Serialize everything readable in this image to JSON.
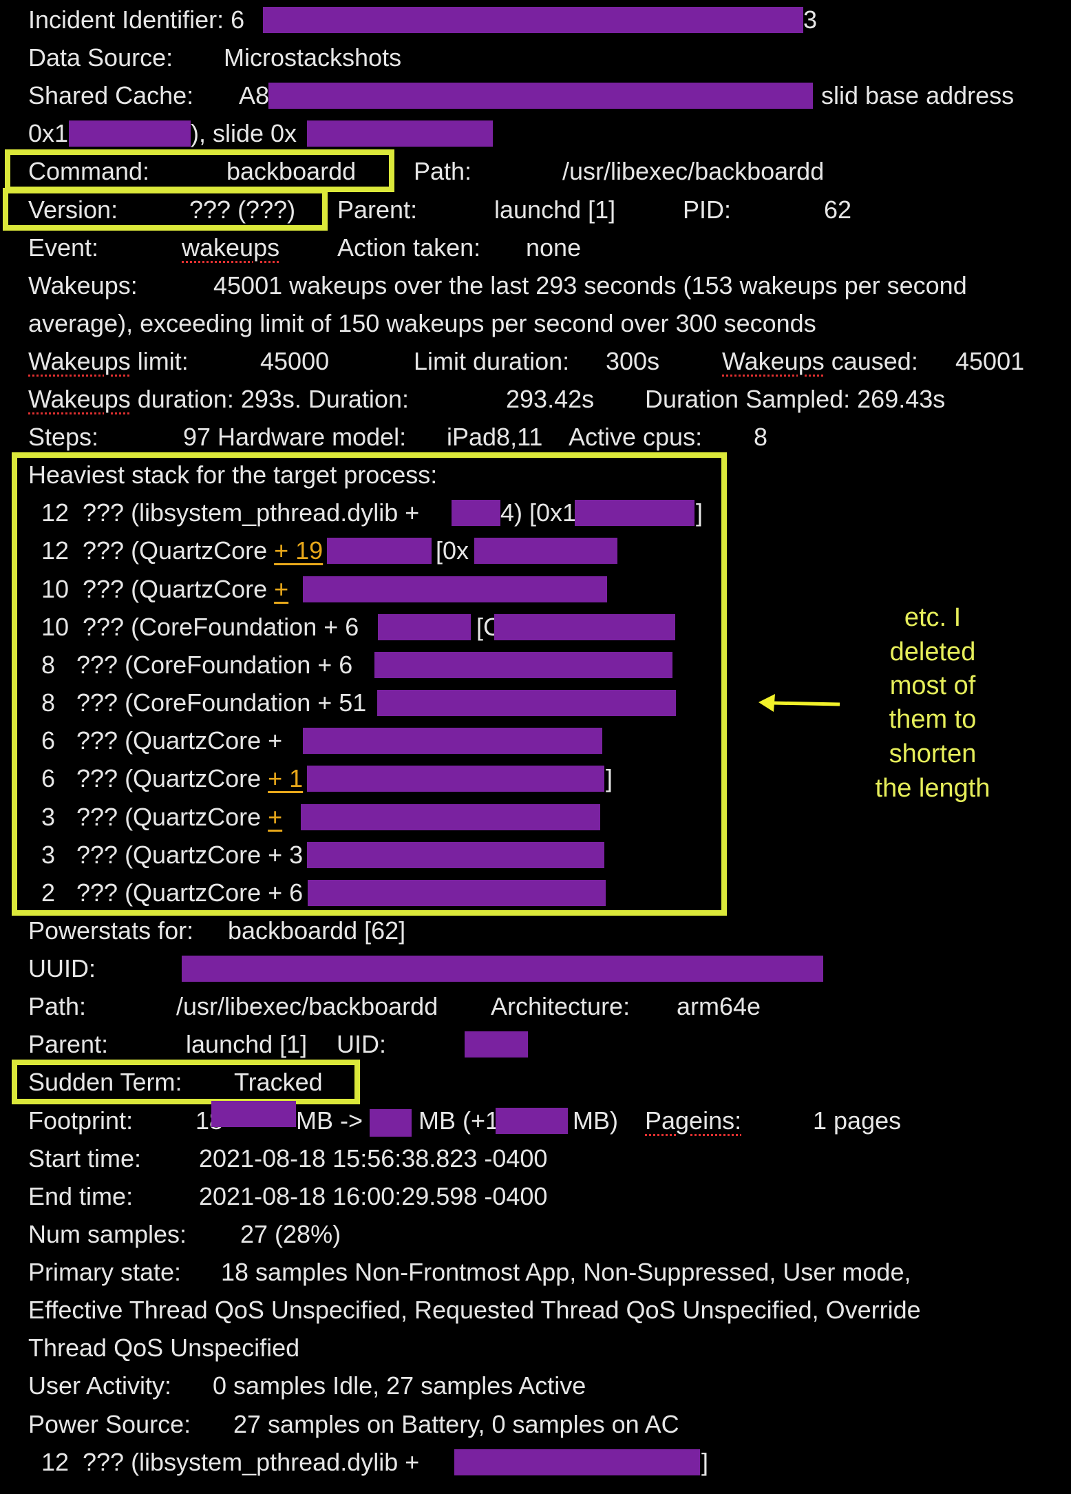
{
  "header": {
    "incident_label": "Incident Identifier: 6",
    "incident_tail": "3",
    "data_source_label": "Data Source:",
    "data_source": "Microstackshots",
    "shared_cache_label": "Shared Cache:",
    "shared_cache_prefix": "A8",
    "slid_base": "slid base address",
    "addr_prefix": "0x1",
    "slide_label": "), slide 0x"
  },
  "process": {
    "command_label": "Command:",
    "command": "backboardd",
    "path_label": "Path:",
    "path": "/usr/libexec/backboardd",
    "version_label": "Version:",
    "version": "??? (???)",
    "parent_label": "Parent:",
    "parent": "launchd [1]",
    "pid_label": "PID:",
    "pid": "62",
    "event_label": "Event:",
    "event": "wakeups",
    "action_label": "Action taken:",
    "action": "none",
    "wakeups_label": "Wakeups:",
    "wakeups_line1": "45001 wakeups over the last 293 seconds (153 wakeups per second",
    "wakeups_line2": "average), exceeding limit of 150 wakeups per second over 300 seconds",
    "wakeups_word": "Wakeups",
    "limit_suffix": " limit:",
    "wakeups_limit": "45000",
    "limit_duration_label": "Limit duration:",
    "limit_duration": "300s",
    "caused_suffix": " caused:",
    "wakeups_caused": "45001",
    "duration_suffix": " duration: 293s. Duration:",
    "duration": "293.42s",
    "duration_sampled": "Duration Sampled: 269.43s",
    "steps_label": "Steps:",
    "steps": "97 Hardware model:",
    "hardware_model": "iPad8,11",
    "cpus_label": "Active cpus:",
    "cpus": "8"
  },
  "stack": {
    "title": "Heaviest stack for the target process:",
    "rows": [
      {
        "count": "12",
        "frame": "??? (libsystem_pthread.dylib + ",
        "mid": "4) [0x1",
        "end": "]"
      },
      {
        "count": "12",
        "frame": "??? (QuartzCore ",
        "offset": "+ 19",
        "mid": "[0x"
      },
      {
        "count": "10",
        "frame": "??? (QuartzCore ",
        "offset": "+"
      },
      {
        "count": "10",
        "frame": "??? (CoreFoundation + 6",
        "mid": "[C"
      },
      {
        "count": "8",
        "frame": "??? (CoreFoundation + 6"
      },
      {
        "count": "8",
        "frame": "??? (CoreFoundation + 51"
      },
      {
        "count": "6",
        "frame": "??? (QuartzCore +"
      },
      {
        "count": "6",
        "frame": "??? (QuartzCore ",
        "offset": "+ 1",
        "end": "]"
      },
      {
        "count": "3",
        "frame": "??? (QuartzCore ",
        "offset": "+"
      },
      {
        "count": "3",
        "frame": "??? (QuartzCore + 3"
      },
      {
        "count": "2",
        "frame": "??? (QuartzCore + 6"
      }
    ]
  },
  "annotation": {
    "lines": [
      "etc.  I",
      "deleted",
      "most of",
      "them to",
      "shorten",
      "the length"
    ],
    "arrow": "arrow-left-icon"
  },
  "powerstats": {
    "label": "Powerstats for:",
    "value": "backboardd [62]",
    "uuid_label": "UUID:",
    "path_label": "Path:",
    "path": "/usr/libexec/backboardd",
    "arch_label": "Architecture:",
    "arch": "arm64e",
    "parent_label": "Parent:",
    "parent": "launchd [1]",
    "uid_label": "UID:",
    "sudden_label": "Sudden Term:",
    "sudden": "Tracked",
    "footprint_label": "Footprint:",
    "fp_a": "18",
    "fp_b": "MB ->",
    "fp_c": "MB (+1",
    "fp_d": "MB)",
    "pageins_label": "Pageins:",
    "pageins": "1 pages",
    "start_label": "Start time:",
    "start": "2021-08-18 15:56:38.823 -0400",
    "end_label": "End time:",
    "end": "2021-08-18 16:00:29.598 -0400",
    "samples_label": "Num samples:",
    "samples": "27 (28%)",
    "primary_label": "Primary state:",
    "primary1": "18 samples Non-Frontmost App, Non-Suppressed, User mode,",
    "primary2": "Effective Thread QoS Unspecified, Requested Thread QoS Unspecified, Override",
    "primary3": "Thread QoS Unspecified",
    "activity_label": "User Activity:",
    "activity": "0 samples Idle, 27 samples Active",
    "power_label": "Power Source:",
    "power": "27 samples on Battery, 0 samples on AC",
    "last_count": "12",
    "last_frame": "??? (libsystem_pthread.dylib + ",
    "last_end": "]"
  },
  "colors": {
    "redaction": "#7a22a0",
    "highlight": "#dbe83a",
    "annotation": "#e6ee5a",
    "link": "#e8a81a"
  }
}
